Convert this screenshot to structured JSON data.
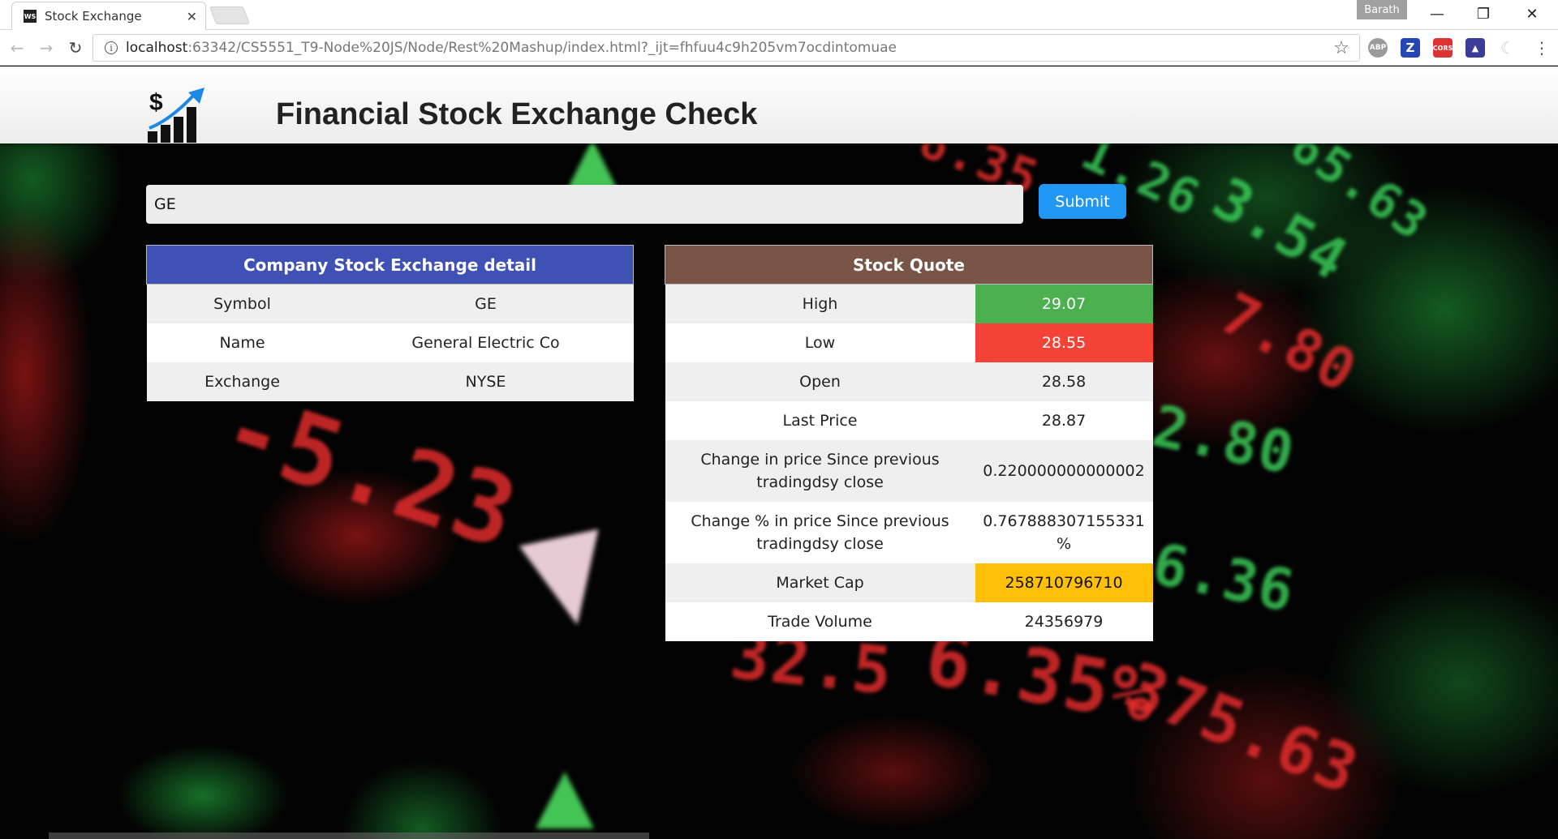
{
  "browser": {
    "tab_title": "Stock Exchange",
    "tab_favicon_text": "WS",
    "profile_name": "Barath",
    "url_host": "localhost",
    "url_rest": ":63342/CS5551_T9-Node%20JS/Node/Rest%20Mashup/index.html?_ijt=fhfuu4c9h205vm7ocdintomuae",
    "icons": [
      "back-arrow-icon",
      "forward-arrow-icon",
      "reload-icon",
      "info-icon",
      "star-icon",
      "adblock-icon",
      "z-extension-icon",
      "cors-icon",
      "photo-extension-icon",
      "moon-extension-icon",
      "menu-icon"
    ]
  },
  "header": {
    "title": "Financial Stock Exchange Check",
    "logo_symbol": "$"
  },
  "search": {
    "value": "GE",
    "submit_label": "Submit"
  },
  "company": {
    "heading": "Company Stock Exchange detail",
    "rows": [
      {
        "label": "Symbol",
        "value": "GE"
      },
      {
        "label": "Name",
        "value": "General Electric Co"
      },
      {
        "label": "Exchange",
        "value": "NYSE"
      }
    ]
  },
  "quote": {
    "heading": "Stock Quote",
    "rows": [
      {
        "label": "High",
        "value": "29.07"
      },
      {
        "label": "Low",
        "value": "28.55"
      },
      {
        "label": "Open",
        "value": "28.58"
      },
      {
        "label": "Last Price",
        "value": "28.87"
      },
      {
        "label": "Change in price Since previous tradingdsy close",
        "value": "0.220000000000002"
      },
      {
        "label": "Change % in price Since previous tradingdsy close",
        "value": "0.767888307155331 %"
      },
      {
        "label": "Market Cap",
        "value": "258710796710"
      },
      {
        "label": "Trade Volume",
        "value": "24356979"
      }
    ]
  },
  "background_ticker": [
    "-5.23",
    "6.35%",
    "32.5",
    "375.63",
    "3.54",
    "2.80",
    "65.63",
    "6.36",
    "1.26",
    "7.80",
    "6.35"
  ],
  "colors": {
    "company_header": "#3f51b5",
    "quote_header": "#795548",
    "high": "#4caf50",
    "low": "#f44336",
    "market_cap": "#ffc107",
    "submit": "#2196f3"
  }
}
